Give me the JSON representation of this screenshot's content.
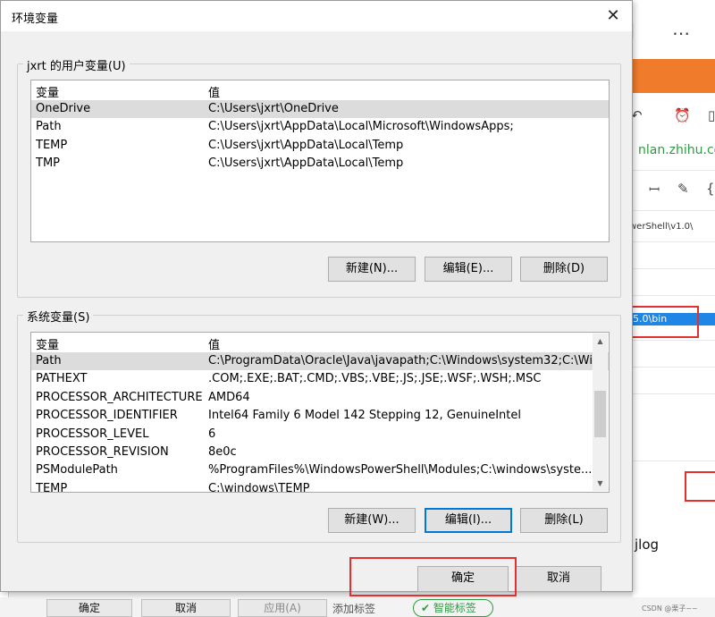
{
  "dialog": {
    "title": "环境变量",
    "user_group_label": "jxrt 的用户变量(U)",
    "system_group_label": "系统变量(S)",
    "col_variable": "变量",
    "col_value": "值",
    "user_vars": [
      {
        "name": "OneDrive",
        "value": "C:\\Users\\jxrt\\OneDrive"
      },
      {
        "name": "Path",
        "value": "C:\\Users\\jxrt\\AppData\\Local\\Microsoft\\WindowsApps;"
      },
      {
        "name": "TEMP",
        "value": "C:\\Users\\jxrt\\AppData\\Local\\Temp"
      },
      {
        "name": "TMP",
        "value": "C:\\Users\\jxrt\\AppData\\Local\\Temp"
      }
    ],
    "system_vars": [
      {
        "name": "Path",
        "value": "C:\\ProgramData\\Oracle\\Java\\javapath;C:\\Windows\\system32;C:\\Wi..."
      },
      {
        "name": "PATHEXT",
        "value": ".COM;.EXE;.BAT;.CMD;.VBS;.VBE;.JS;.JSE;.WSF;.WSH;.MSC"
      },
      {
        "name": "PROCESSOR_ARCHITECTURE",
        "value": "AMD64"
      },
      {
        "name": "PROCESSOR_IDENTIFIER",
        "value": "Intel64 Family 6 Model 142 Stepping 12, GenuineIntel"
      },
      {
        "name": "PROCESSOR_LEVEL",
        "value": "6"
      },
      {
        "name": "PROCESSOR_REVISION",
        "value": "8e0c"
      },
      {
        "name": "PSModulePath",
        "value": "%ProgramFiles%\\WindowsPowerShell\\Modules;C:\\windows\\syste..."
      },
      {
        "name": "TEMP",
        "value": "C:\\windows\\TEMP"
      }
    ],
    "user_buttons": {
      "new": "新建(N)...",
      "edit": "编辑(E)...",
      "delete": "删除(D)"
    },
    "system_buttons": {
      "new": "新建(W)...",
      "edit": "编辑(I)...",
      "delete": "删除(L)"
    },
    "ok": "确定",
    "cancel": "取消"
  },
  "background": {
    "url_fragment": "nlan.zhihu.com",
    "powershell_fragment": "werShell\\v1.0\\",
    "selected_fragment": "5.0\\bin",
    "jlog": "jlog",
    "ok": "确定",
    "cancel": "取消",
    "apply": "应用(A)",
    "add_tag": "添加标签",
    "smart_tag": "智能标签",
    "watermark": "CSDN @栗子~~"
  },
  "colors": {
    "highlight_red": "#e23030",
    "focus_blue": "#0078d7",
    "brand_orange": "#f07c2b",
    "zhihu_green": "#2e9a43"
  }
}
